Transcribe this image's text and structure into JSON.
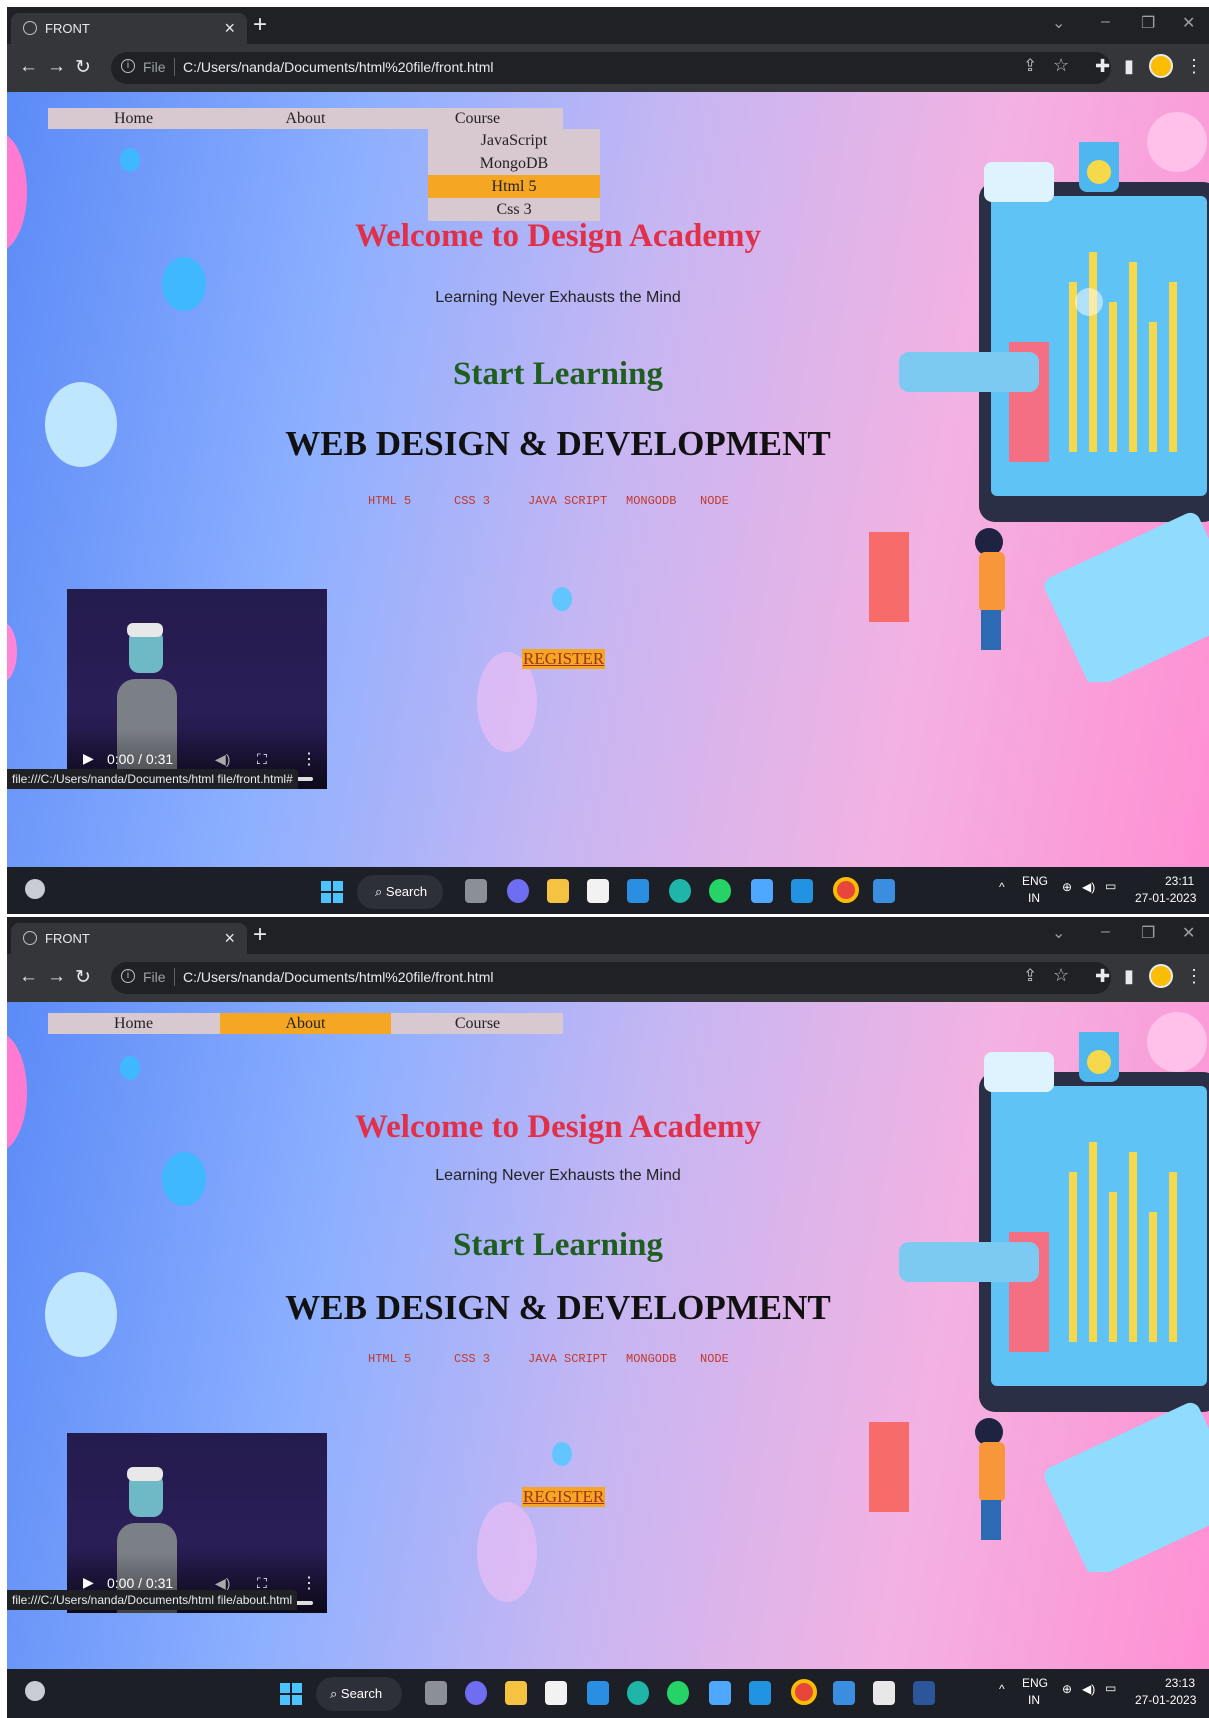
{
  "screens": [
    {
      "browser": {
        "tab_title": "FRONT",
        "tab_close": "×",
        "new_tab": "+",
        "url_scheme": "File",
        "url": "C:/Users/nanda/Documents/html%20file/front.html"
      },
      "nav": {
        "items": [
          "Home",
          "About",
          "Course"
        ],
        "active": ""
      },
      "dropdown": {
        "items": [
          "JavaScript",
          "MongoDB",
          "Html 5",
          "Css 3"
        ],
        "active": "Html 5"
      },
      "hero": {
        "welcome": "Welcome to Design Academy",
        "tagline": "Learning Never Exhausts the Mind",
        "start": "Start Learning",
        "headline": "WEB DESIGN & DEVELOPMENT",
        "techs": [
          "HTML 5",
          "CSS 3",
          "JAVA SCRIPT",
          "MONGODB",
          "NODE"
        ],
        "register": "REGISTER"
      },
      "video": {
        "time": "0:00 / 0:31"
      },
      "status_url": "file:///C:/Users/nanda/Documents/html file/front.html#",
      "taskbar": {
        "search": "Search",
        "lang_top": "ENG",
        "lang_bottom": "IN",
        "time": "23:11",
        "date": "27-01-2023"
      }
    },
    {
      "browser": {
        "tab_title": "FRONT",
        "tab_close": "×",
        "new_tab": "+",
        "url_scheme": "File",
        "url": "C:/Users/nanda/Documents/html%20file/front.html"
      },
      "nav": {
        "items": [
          "Home",
          "About",
          "Course"
        ],
        "active": "About"
      },
      "hero": {
        "welcome": "Welcome to Design Academy",
        "tagline": "Learning Never Exhausts the Mind",
        "start": "Start Learning",
        "headline": "WEB DESIGN & DEVELOPMENT",
        "techs": [
          "HTML 5",
          "CSS 3",
          "JAVA SCRIPT",
          "MONGODB",
          "NODE"
        ],
        "register": "REGISTER"
      },
      "video": {
        "time": "0:00 / 0:31"
      },
      "status_url": "file:///C:/Users/nanda/Documents/html file/about.html",
      "taskbar": {
        "search": "Search",
        "lang_top": "ENG",
        "lang_bottom": "IN",
        "time": "23:13",
        "date": "27-01-2023"
      }
    }
  ],
  "colors": {
    "accent": "#f5a623",
    "welcome": "#e0304a",
    "start": "#1f5e1f",
    "nav_bg": "#d8c8cf"
  }
}
